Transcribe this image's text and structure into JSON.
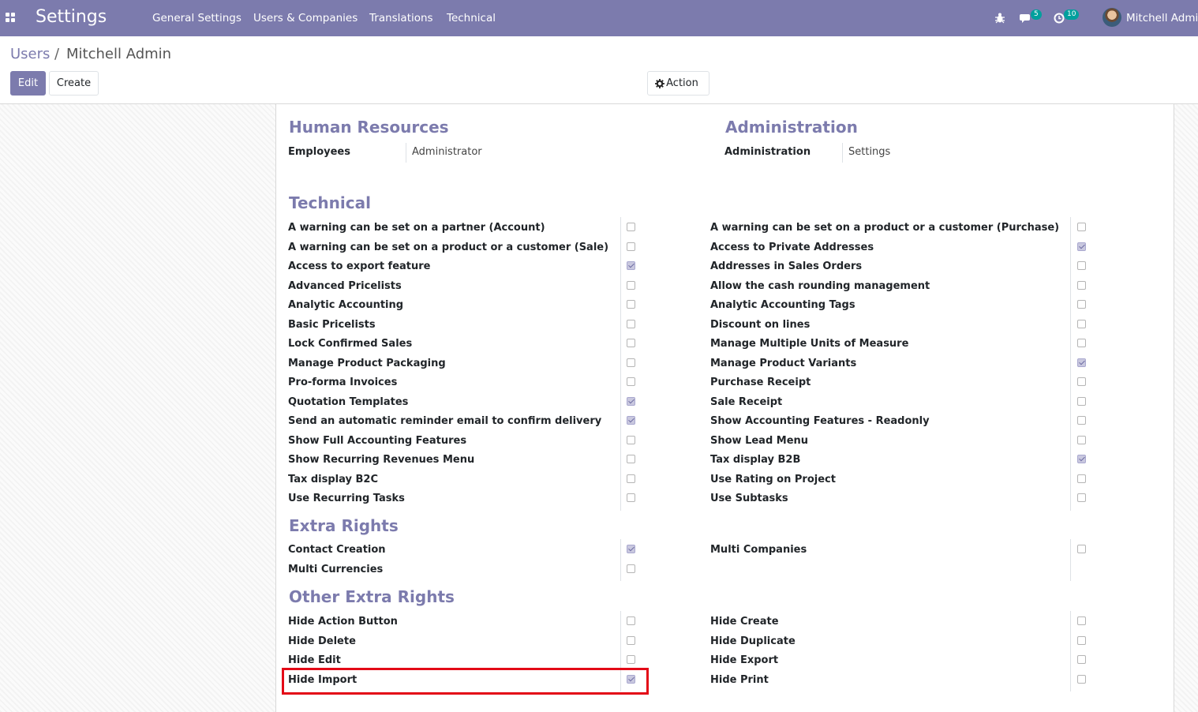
{
  "navbar": {
    "brand": "Settings",
    "menus": [
      "General Settings",
      "Users & Companies",
      "Translations",
      "Technical"
    ],
    "messages_count": "5",
    "activities_count": "10",
    "user_name": "Mitchell Admin",
    "colors": {
      "navbar": "#7c7bad",
      "badge": "#00a09d"
    }
  },
  "breadcrumb": {
    "parent": "Users",
    "separator": "/",
    "current": "Mitchell Admin"
  },
  "buttons": {
    "edit": "Edit",
    "create": "Create",
    "action": "Action"
  },
  "sections": {
    "hr": {
      "title": "Human Resources",
      "field": "Employees",
      "value": "Administrator"
    },
    "admin": {
      "title": "Administration",
      "field": "Administration",
      "value": "Settings"
    },
    "technical": {
      "title": "Technical",
      "left": [
        {
          "label": "A warning can be set on a partner (Account)",
          "checked": false
        },
        {
          "label": "A warning can be set on a product or a customer (Sale)",
          "checked": false
        },
        {
          "label": "Access to export feature",
          "checked": true
        },
        {
          "label": "Advanced Pricelists",
          "checked": false
        },
        {
          "label": "Analytic Accounting",
          "checked": false
        },
        {
          "label": "Basic Pricelists",
          "checked": false
        },
        {
          "label": "Lock Confirmed Sales",
          "checked": false
        },
        {
          "label": "Manage Product Packaging",
          "checked": false
        },
        {
          "label": "Pro-forma Invoices",
          "checked": false
        },
        {
          "label": "Quotation Templates",
          "checked": true
        },
        {
          "label": "Send an automatic reminder email to confirm delivery",
          "checked": true
        },
        {
          "label": "Show Full Accounting Features",
          "checked": false
        },
        {
          "label": "Show Recurring Revenues Menu",
          "checked": false
        },
        {
          "label": "Tax display B2C",
          "checked": false
        },
        {
          "label": "Use Recurring Tasks",
          "checked": false
        }
      ],
      "right": [
        {
          "label": "A warning can be set on a product or a customer (Purchase)",
          "checked": false
        },
        {
          "label": "Access to Private Addresses",
          "checked": true
        },
        {
          "label": "Addresses in Sales Orders",
          "checked": false
        },
        {
          "label": "Allow the cash rounding management",
          "checked": false
        },
        {
          "label": "Analytic Accounting Tags",
          "checked": false
        },
        {
          "label": "Discount on lines",
          "checked": false
        },
        {
          "label": "Manage Multiple Units of Measure",
          "checked": false
        },
        {
          "label": "Manage Product Variants",
          "checked": true
        },
        {
          "label": "Purchase Receipt",
          "checked": false
        },
        {
          "label": "Sale Receipt",
          "checked": false
        },
        {
          "label": "Show Accounting Features - Readonly",
          "checked": false
        },
        {
          "label": "Show Lead Menu",
          "checked": false
        },
        {
          "label": "Tax display B2B",
          "checked": true
        },
        {
          "label": "Use Rating on Project",
          "checked": false
        },
        {
          "label": "Use Subtasks",
          "checked": false
        }
      ]
    },
    "extra": {
      "title": "Extra Rights",
      "left": [
        {
          "label": "Contact Creation",
          "checked": true
        },
        {
          "label": "Multi Currencies",
          "checked": false
        }
      ],
      "right": [
        {
          "label": "Multi Companies",
          "checked": false
        }
      ]
    },
    "other": {
      "title": "Other Extra Rights",
      "left": [
        {
          "label": "Hide Action Button",
          "checked": false
        },
        {
          "label": "Hide Delete",
          "checked": false
        },
        {
          "label": "Hide Edit",
          "checked": false
        },
        {
          "label": "Hide Import",
          "checked": true
        }
      ],
      "right": [
        {
          "label": "Hide Create",
          "checked": false
        },
        {
          "label": "Hide Duplicate",
          "checked": false
        },
        {
          "label": "Hide Export",
          "checked": false
        },
        {
          "label": "Hide Print",
          "checked": false
        }
      ]
    }
  }
}
